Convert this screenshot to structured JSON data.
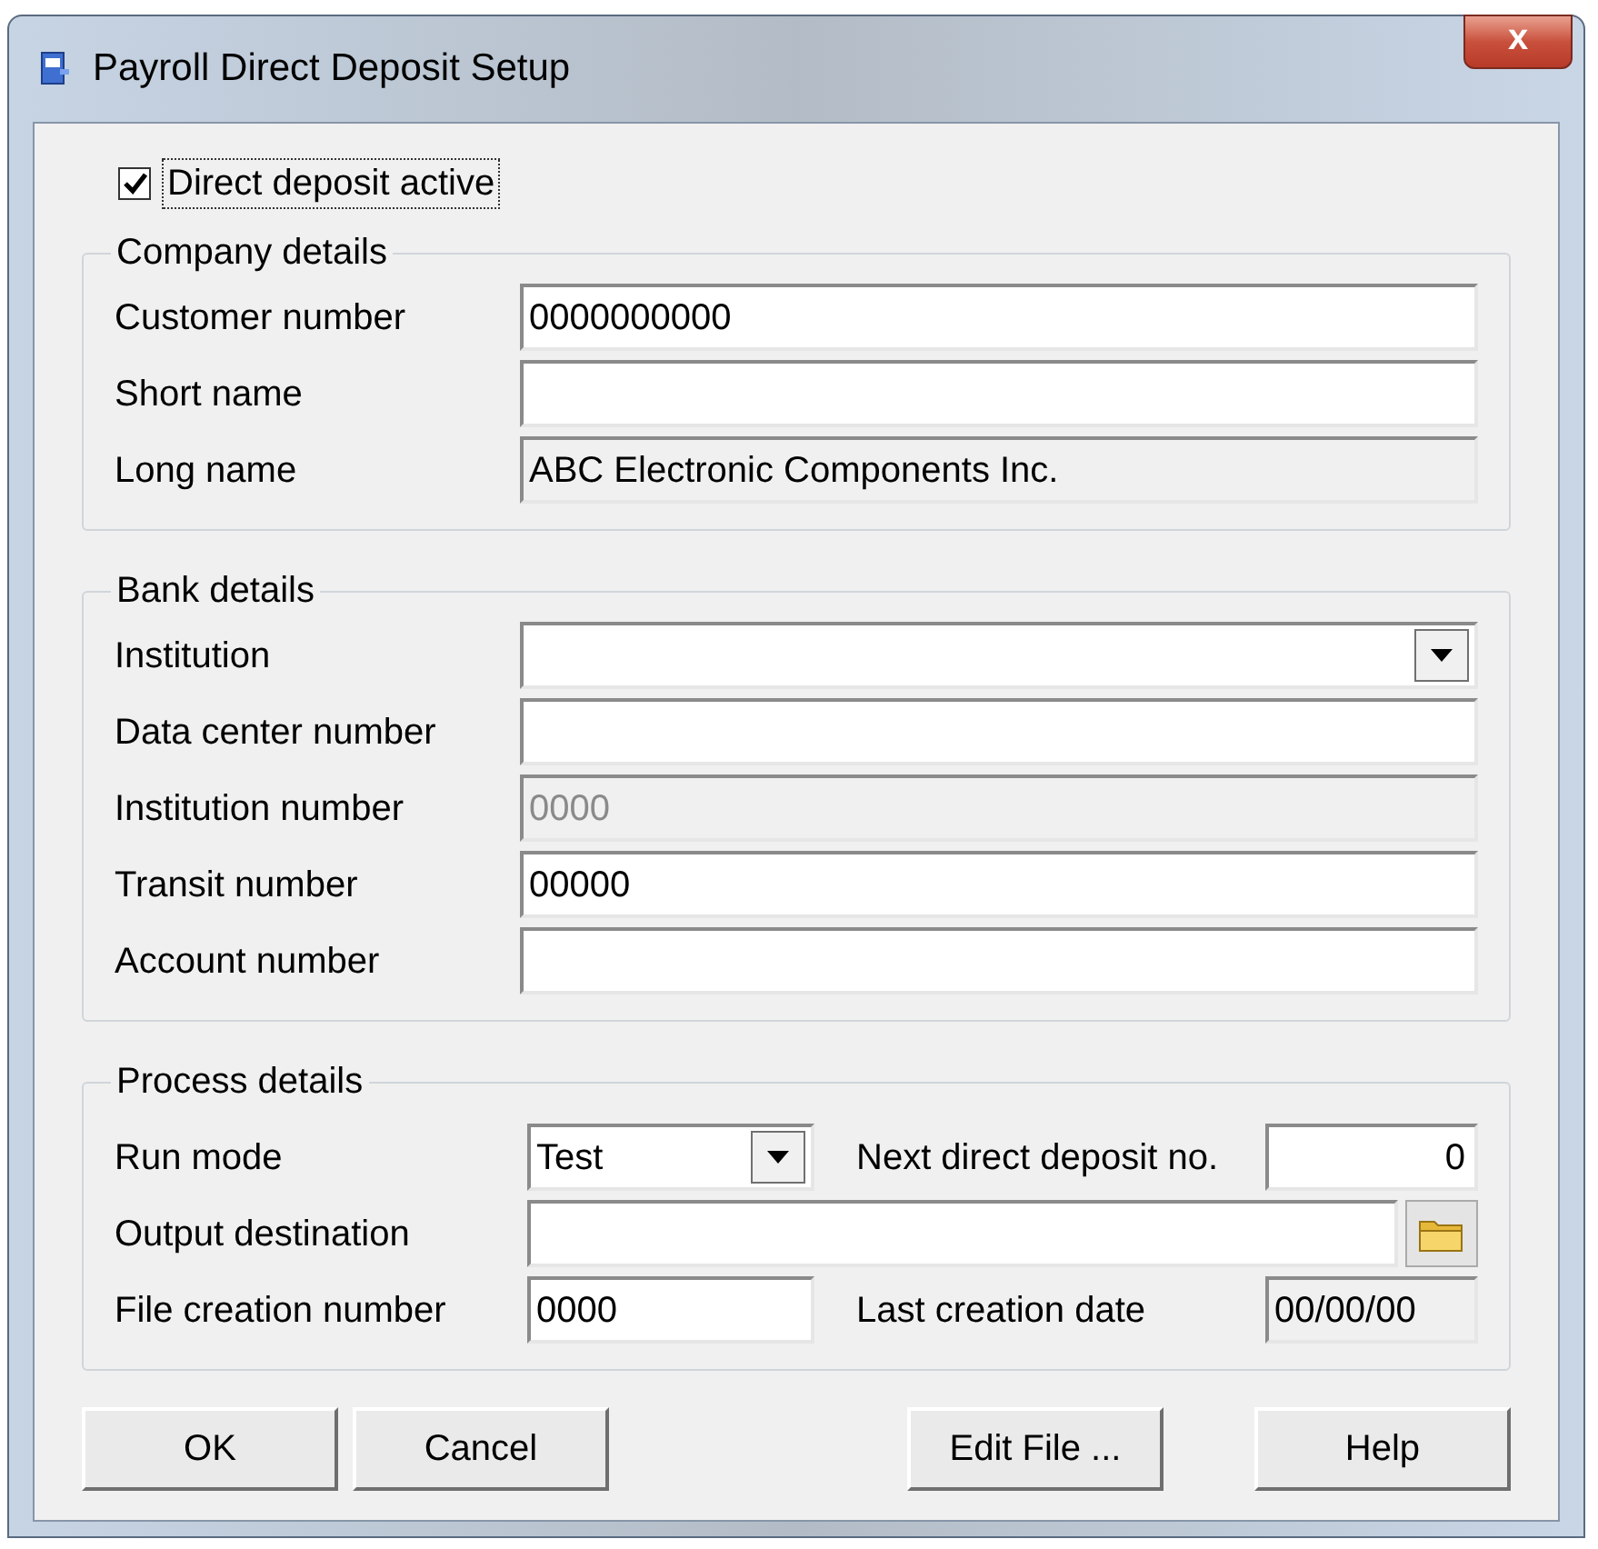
{
  "window": {
    "title": "Payroll Direct Deposit Setup",
    "close_label": "x"
  },
  "active_checkbox": {
    "label": "Direct deposit active",
    "checked": true
  },
  "groups": [
    {
      "title": "Company details",
      "rows": [
        {
          "label": "Customer number",
          "field": {
            "kind": "text",
            "value": "0000000000",
            "disabled": false
          }
        },
        {
          "label": "Short name",
          "field": {
            "kind": "text",
            "disabled": false
          }
        },
        {
          "label": "Long name",
          "field": {
            "kind": "text",
            "value": "ABC Electronic Components Inc.",
            "disabled": true
          }
        }
      ]
    },
    {
      "title": "Bank details",
      "rows": [
        {
          "label": "Institution",
          "field": {
            "kind": "combo",
            "disabled": false
          }
        },
        {
          "label": "Data center number",
          "field": {
            "kind": "text",
            "disabled": false
          }
        },
        {
          "label": "Institution number",
          "field": {
            "kind": "text",
            "value": "0000",
            "disabled": true
          }
        },
        {
          "label": "Transit number",
          "field": {
            "kind": "text",
            "value": "00000",
            "disabled": false
          }
        },
        {
          "label": "Account number",
          "field": {
            "kind": "text",
            "disabled": false
          }
        }
      ]
    }
  ],
  "process": {
    "title": "Process details",
    "run_mode": {
      "label": "Run mode",
      "value": "Test"
    },
    "next_deposit": {
      "label": "Next direct deposit no.",
      "value": "0"
    },
    "output_destination": {
      "label": "Output destination"
    },
    "file_creation": {
      "label": "File creation number",
      "value": "0000"
    },
    "last_creation": {
      "label": "Last creation date",
      "value": "00/00/00",
      "disabled": true
    }
  },
  "buttons": [
    "OK",
    "Cancel",
    "Edit File ...",
    "Help"
  ]
}
